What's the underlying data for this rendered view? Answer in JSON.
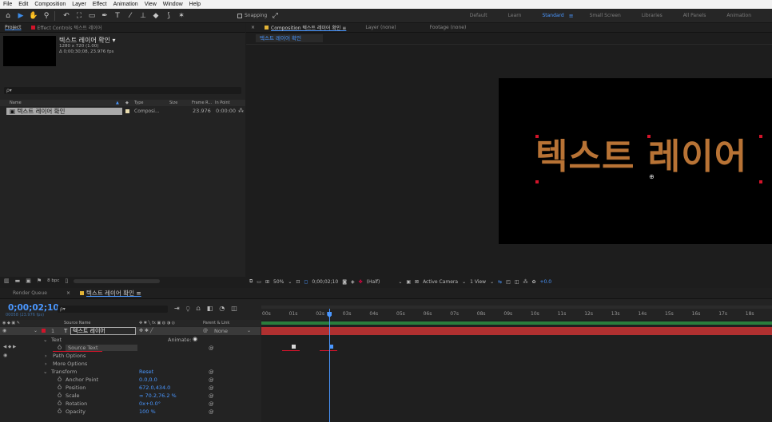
{
  "menu": [
    "File",
    "Edit",
    "Composition",
    "Layer",
    "Effect",
    "Animation",
    "View",
    "Window",
    "Help"
  ],
  "toolbar": {
    "snapping_label": "Snapping",
    "workspaces": [
      {
        "label": "Default",
        "active": false
      },
      {
        "label": "Learn",
        "active": false
      },
      {
        "label": "Standard",
        "active": true
      },
      {
        "label": "Small Screen",
        "active": false
      },
      {
        "label": "Libraries",
        "active": false
      },
      {
        "label": "All Panels",
        "active": false
      },
      {
        "label": "Animation",
        "active": false
      }
    ]
  },
  "project_panel": {
    "tab_label": "Project",
    "effect_controls_label": "Effect Controls 텍스트 레이어",
    "comp_name": "텍스트 레이어 확인 ▾",
    "comp_info_1": "1280 x 720 (1.00)",
    "comp_info_2": "Δ 0;00;30;08, 23.976 fps",
    "search_placeholder": "ρ▾",
    "columns": [
      "Name",
      "Type",
      "Size",
      "Frame R...",
      "In Point"
    ],
    "item_name": "텍스트 레이어 확인",
    "item_type": "Composi...",
    "item_fps": "23.976",
    "item_in": "0:00:00",
    "bpc": "8 bpc"
  },
  "composition_panel": {
    "tab_label": "Composition 텍스트 레이어 확인",
    "layer_tab": "Layer (none)",
    "footage_tab": "Footage (none)",
    "subtab": "텍스트 레이어 확인",
    "canvas_text": "텍스트 레이어",
    "zoom": "50%",
    "timecode": "0;00;02;10",
    "resolution": "(Half)",
    "camera": "Active Camera",
    "views": "1 View",
    "exposure": "+0.0"
  },
  "timeline": {
    "render_queue_tab": "Render Queue",
    "comp_tab": "텍스트 레이어 확인",
    "current_time": "0;00;02;10",
    "fps_info": "00058 (23.976 fps)",
    "search_placeholder": "ρ▾",
    "columns": {
      "source_name": "Source Name",
      "parent": "Parent & Link"
    },
    "layer": {
      "number": "1",
      "name": "텍스트 레이어",
      "parent": "None"
    },
    "props": {
      "text": "Text",
      "animate": "Animate:",
      "source_text": "Source Text",
      "path_options": "Path Options",
      "more_options": "More Options",
      "transform": "Transform",
      "reset": "Reset",
      "anchor_point": "Anchor Point",
      "anchor_value": "0.0,0.0",
      "position": "Position",
      "position_value": "672.0,434.0",
      "scale": "Scale",
      "scale_value": "∞ 70.2,76.2 %",
      "rotation": "Rotation",
      "rotation_value": "0x+0.0°",
      "opacity": "Opacity",
      "opacity_value": "100 %"
    },
    "ruler": [
      "00s",
      "01s",
      "02s",
      "03s",
      "04s",
      "05s",
      "06s",
      "07s",
      "08s",
      "09s",
      "10s",
      "11s",
      "12s",
      "13s",
      "14s",
      "15s",
      "16s",
      "17s",
      "18s"
    ],
    "current_time_seconds": 2.42,
    "keyframe_seconds": [
      1.0,
      2.0
    ]
  },
  "colors": {
    "accent": "#4a97ff",
    "text_fill": "#b87335",
    "label_red": "#d2142a"
  }
}
